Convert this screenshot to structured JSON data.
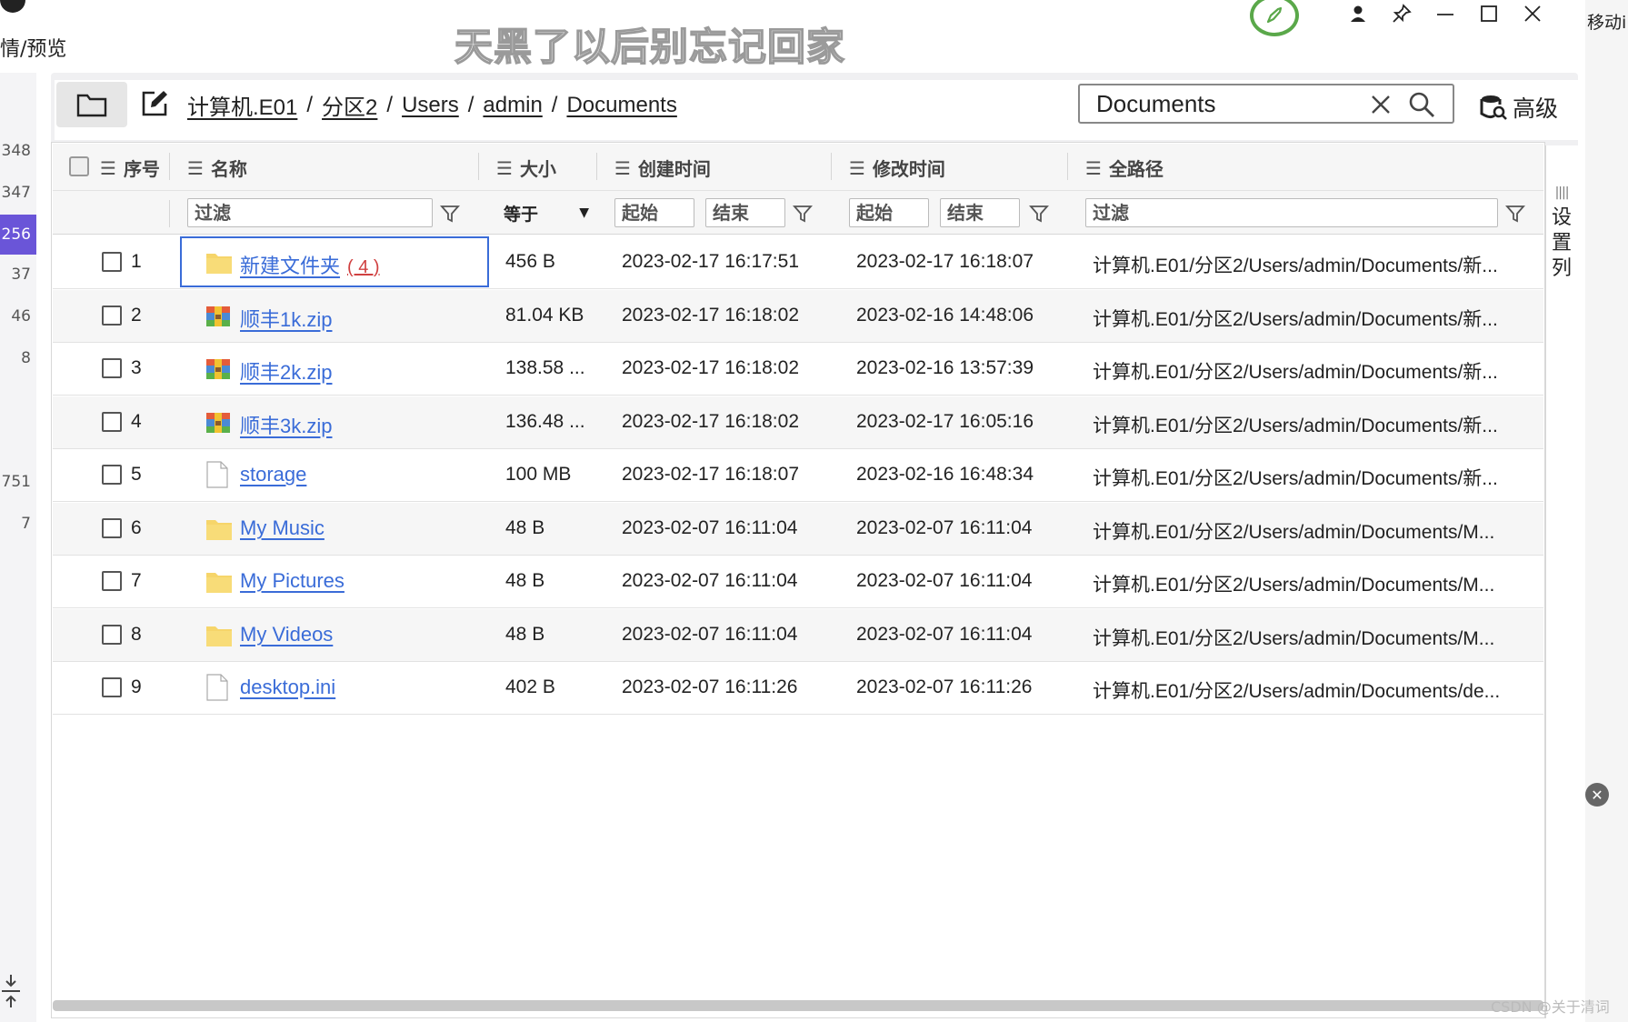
{
  "top": {
    "left_label": "情/预览",
    "marquee": "天黑了以后别忘记回家",
    "right_fragment": "移动i"
  },
  "left_numbers": [
    "348",
    "347",
    "256",
    "37",
    "46",
    "8",
    "751",
    "7"
  ],
  "toolbar": {
    "breadcrumb": [
      "计算机.E01",
      "分区2",
      "Users",
      "admin",
      "Documents"
    ],
    "breadcrumb_sep": "/",
    "search_value": "Documents",
    "advanced_label": "高级"
  },
  "table": {
    "headers": {
      "index": "序号",
      "name": "名称",
      "size": "大小",
      "created": "创建时间",
      "modified": "修改时间",
      "path": "全路径"
    },
    "filters": {
      "name_placeholder": "过滤",
      "size_op": "等于",
      "created_start": "起始",
      "created_end": "结束",
      "modified_start": "起始",
      "modified_end": "结束",
      "path_placeholder": "过滤"
    },
    "rows": [
      {
        "index": "1",
        "name": "新建文件夹",
        "count": "( 4 )",
        "type": "folder",
        "size": "456 B",
        "created": "2023-02-17 16:17:51",
        "modified": "2023-02-17 16:18:07",
        "path": "计算机.E01/分区2/Users/admin/Documents/新..."
      },
      {
        "index": "2",
        "name": "顺丰1k.zip",
        "count": "",
        "type": "zip",
        "size": "81.04 KB",
        "created": "2023-02-17 16:18:02",
        "modified": "2023-02-16 14:48:06",
        "path": "计算机.E01/分区2/Users/admin/Documents/新..."
      },
      {
        "index": "3",
        "name": "顺丰2k.zip",
        "count": "",
        "type": "zip",
        "size": "138.58 ...",
        "created": "2023-02-17 16:18:02",
        "modified": "2023-02-16 13:57:39",
        "path": "计算机.E01/分区2/Users/admin/Documents/新..."
      },
      {
        "index": "4",
        "name": "顺丰3k.zip",
        "count": "",
        "type": "zip",
        "size": "136.48 ...",
        "created": "2023-02-17 16:18:02",
        "modified": "2023-02-17 16:05:16",
        "path": "计算机.E01/分区2/Users/admin/Documents/新..."
      },
      {
        "index": "5",
        "name": "storage",
        "count": "",
        "type": "file",
        "size": "100 MB",
        "created": "2023-02-17 16:18:07",
        "modified": "2023-02-16 16:48:34",
        "path": "计算机.E01/分区2/Users/admin/Documents/新..."
      },
      {
        "index": "6",
        "name": "My Music",
        "count": "",
        "type": "folder",
        "size": "48 B",
        "created": "2023-02-07 16:11:04",
        "modified": "2023-02-07 16:11:04",
        "path": "计算机.E01/分区2/Users/admin/Documents/M..."
      },
      {
        "index": "7",
        "name": "My Pictures",
        "count": "",
        "type": "folder",
        "size": "48 B",
        "created": "2023-02-07 16:11:04",
        "modified": "2023-02-07 16:11:04",
        "path": "计算机.E01/分区2/Users/admin/Documents/M..."
      },
      {
        "index": "8",
        "name": "My Videos",
        "count": "",
        "type": "folder",
        "size": "48 B",
        "created": "2023-02-07 16:11:04",
        "modified": "2023-02-07 16:11:04",
        "path": "计算机.E01/分区2/Users/admin/Documents/M..."
      },
      {
        "index": "9",
        "name": "desktop.ini",
        "count": "",
        "type": "file",
        "size": "402 B",
        "created": "2023-02-07 16:11:26",
        "modified": "2023-02-07 16:11:26",
        "path": "计算机.E01/分区2/Users/admin/Documents/de..."
      }
    ]
  },
  "side_settings_label": "设置列",
  "watermark": "CSDN @关于清词",
  "colors": {
    "accent_purple": "#6a55d8",
    "link_blue": "#3a6cd8",
    "count_red": "#d04040",
    "rocket_green": "#5aa84a"
  }
}
